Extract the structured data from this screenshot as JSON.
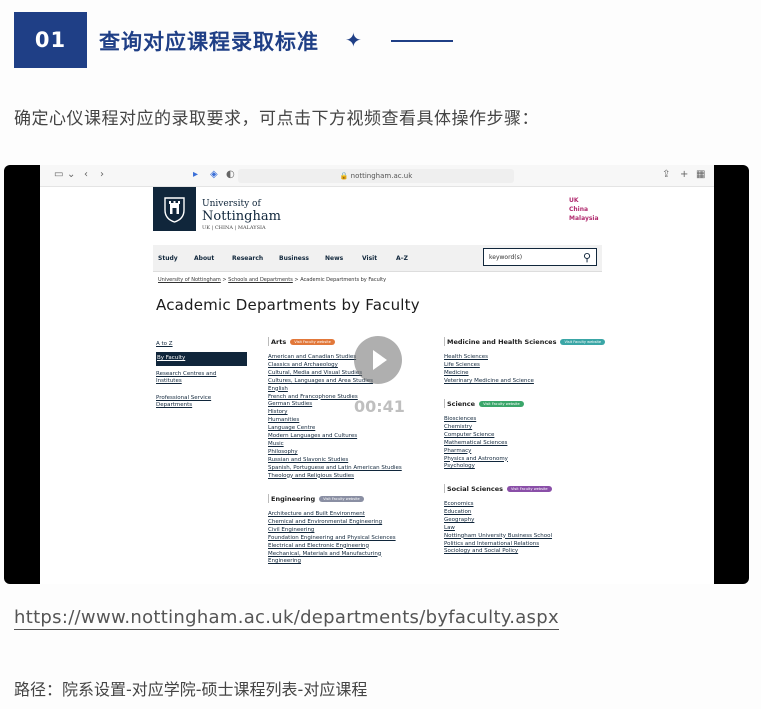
{
  "section": {
    "number": "01",
    "title": "查询对应课程录取标准",
    "star": "✦"
  },
  "intro": "确定心仪课程对应的录取要求，可点击下方视频查看具体操作步骤：",
  "video": {
    "timer": "00:41",
    "browser": {
      "url": "nottingham.ac.uk"
    },
    "site": {
      "uni_line1": "University of",
      "uni_line2": "Nottingham",
      "uni_line3": "UK | CHINA | MALAYSIA",
      "regions": [
        "UK",
        "China",
        "Malaysia"
      ],
      "nav": [
        "Study",
        "About",
        "Research",
        "Business",
        "News",
        "Visit",
        "A–Z"
      ],
      "search_placeholder": "keyword(s)",
      "breadcrumb": [
        "University of Nottingham",
        "Schools and Departments",
        "Academic Departments by Faculty"
      ],
      "heading": "Academic Departments by Faculty",
      "left_nav": [
        "A to Z",
        "By Faculty",
        "Research Centres and",
        "Institutes",
        "Professional Service",
        "Departments"
      ],
      "arts": {
        "title": "Arts",
        "badge": "Visit Faculty website",
        "badge_color": "#e2783a",
        "items": [
          "American and Canadian Studies",
          "Classics and Archaeology",
          "Cultural, Media and Visual Studies",
          "Cultures, Languages and Area Studies",
          "English",
          "French and Francophone Studies",
          "German Studies",
          "History",
          "Humanities",
          "Language Centre",
          "Modern Languages and Cultures",
          "Music",
          "Philosophy",
          "Russian and Slavonic Studies",
          "Spanish, Portuguese and Latin American Studies",
          "Theology and Religious Studies"
        ]
      },
      "engineering": {
        "title": "Engineering",
        "badge": "Visit Faculty website",
        "badge_color": "#8a8fa3",
        "items": [
          "Architecture and Built Environment",
          "Chemical and Environmental Engineering",
          "Civil Engineering",
          "Foundation Engineering and Physical Sciences",
          "Electrical and Electronic Engineering",
          "Mechanical, Materials and Manufacturing",
          "Engineering"
        ]
      },
      "medicine": {
        "title": "Medicine and Health Sciences",
        "badge": "Visit Faculty website",
        "badge_color": "#3aa6a6",
        "items": [
          "Health Sciences",
          "Life Sciences",
          "Medicine",
          "Veterinary Medicine and Science"
        ]
      },
      "science": {
        "title": "Science",
        "badge": "Visit Faculty website",
        "badge_color": "#3aa66a",
        "items": [
          "Biosciences",
          "Chemistry",
          "Computer Science",
          "Mathematical Sciences",
          "Pharmacy",
          "Physics and Astronomy",
          "Psychology"
        ]
      },
      "social": {
        "title": "Social Sciences",
        "badge": "Visit Faculty website",
        "badge_color": "#8a4fa8",
        "items": [
          "Economics",
          "Education",
          "Geography",
          "Law",
          "Nottingham University Business School",
          "Politics and International Relations",
          "Sociology and Social Policy"
        ]
      }
    }
  },
  "link": "https://www.nottingham.ac.uk/departments/byfaculty.aspx",
  "route": "路径：院系设置-对应学院-硕士课程列表-对应课程"
}
